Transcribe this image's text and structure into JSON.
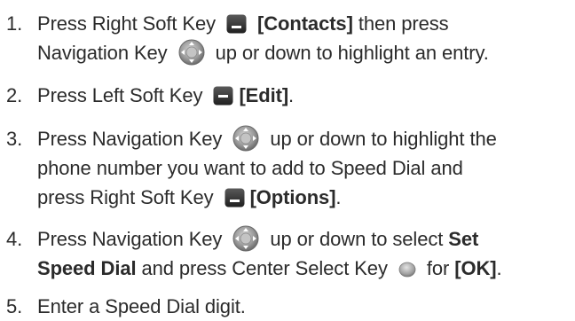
{
  "steps": [
    {
      "number": "1.",
      "line1": {
        "t1": "Press Right Soft Key",
        "b1": "[Contacts]",
        "t2": "then press"
      },
      "line2": {
        "t1": "Navigation Key",
        "t2": "up or down to highlight an entry."
      }
    },
    {
      "number": "2.",
      "line1": {
        "t1": "Press Left Soft Key",
        "b1": "[Edit]",
        "t2": "."
      }
    },
    {
      "number": "3.",
      "line1": {
        "t1": "Press Navigation Key",
        "t2": "up or down to highlight the"
      },
      "line2": {
        "t1": "phone number you want to add to Speed Dial and"
      },
      "line3": {
        "t1": "press Right Soft Key",
        "b1": "[Options]",
        "t2": "."
      }
    },
    {
      "number": "4.",
      "line1": {
        "t1": "Press Navigation Key",
        "t2": "up or down to select",
        "b1": "Set"
      },
      "line2": {
        "b1": "Speed Dial",
        "t1": "and press Center Select Key",
        "t2": "for",
        "b2": "[OK]",
        "t3": "."
      }
    },
    {
      "number": "5.",
      "line1": {
        "t1": "Enter a Speed Dial digit."
      }
    }
  ],
  "icons": {
    "right_soft_key": "right-soft-key-icon",
    "left_soft_key": "left-soft-key-icon",
    "navigation_key": "navigation-key-icon",
    "center_select_key": "center-select-key-icon"
  },
  "colors": {
    "text": "#2b2b2b",
    "key_dark": "#3a3a3a",
    "key_gray": "#8c8c8c"
  }
}
